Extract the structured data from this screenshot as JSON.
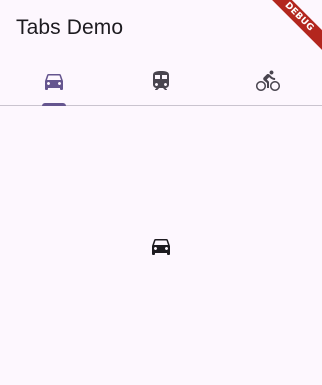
{
  "appbar": {
    "title": "Tabs Demo"
  },
  "tabs": [
    {
      "icon": "directions-car-icon",
      "selected": true
    },
    {
      "icon": "directions-transit-icon",
      "selected": false
    },
    {
      "icon": "directions-bike-icon",
      "selected": false
    }
  ],
  "content": {
    "icon": "directions-car-icon"
  },
  "debug_banner": {
    "label": "DEBUG"
  },
  "colors": {
    "background": "#fdf7fe",
    "selected_tab": "#65558f",
    "unselected_tab": "#49454f",
    "indicator": "#65558f",
    "divider": "#cac4cf",
    "content_icon": "#1d1b20",
    "debug_banner": "#b3261e"
  }
}
